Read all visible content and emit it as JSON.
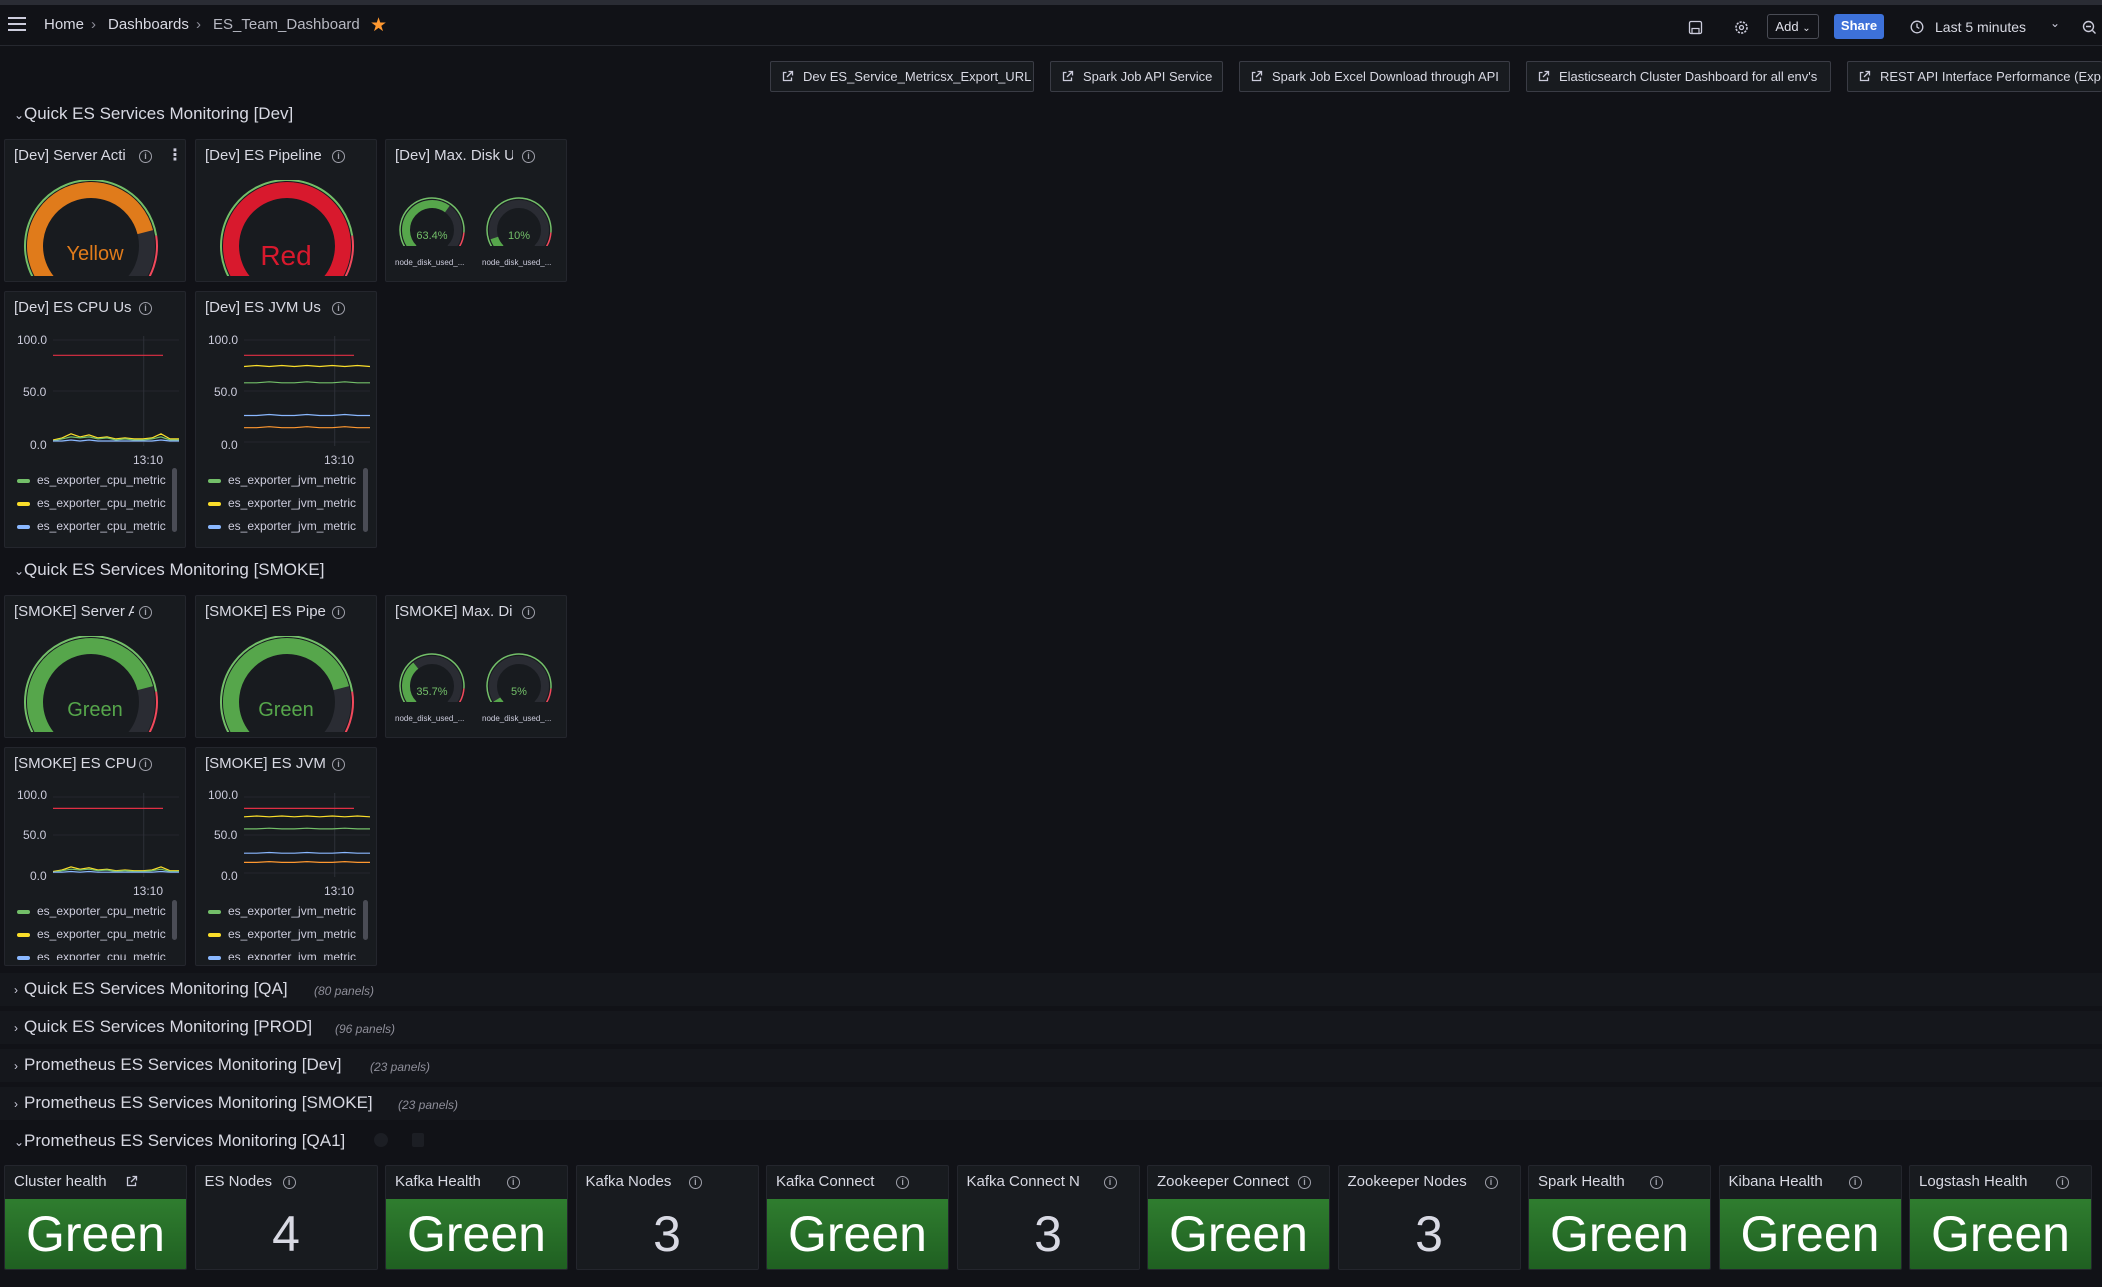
{
  "nav": {
    "breadcrumb": [
      "Home",
      "Dashboards",
      "ES_Team_Dashboard"
    ],
    "add_label": "Add",
    "share_label": "Share",
    "time_range": "Last 5 minutes"
  },
  "links": [
    "Dev ES_Service_Metricsx_Export_URL",
    "Spark Job API Service",
    "Spark Job Excel Download through API",
    "Elasticsearch Cluster Dashboard for all env's",
    "REST API Interface Performance (Exp"
  ],
  "rows": {
    "dev": "Quick ES Services Monitoring [Dev]",
    "smoke": "Quick ES Services Monitoring [SMOKE]",
    "qa": {
      "title": "Quick ES Services Monitoring [QA]",
      "count": "(80 panels)"
    },
    "prod": {
      "title": "Quick ES Services Monitoring [PROD]",
      "count": "(96 panels)"
    },
    "prom_dev": {
      "title": "Prometheus ES Services Monitoring [Dev]",
      "count": "(23 panels)"
    },
    "prom_smoke": {
      "title": "Prometheus ES Services Monitoring [SMOKE]",
      "count": "(23 panels)"
    },
    "prom_qa1": "Prometheus ES Services Monitoring [QA1]"
  },
  "dev": {
    "server": {
      "title": "[Dev] Server Acti",
      "value": "Yellow",
      "color": "#e07b1b",
      "fraction": 0.78
    },
    "pipeline": {
      "title": "[Dev] ES Pipeline",
      "value": "Red",
      "color": "#d8192d",
      "fraction": 1.0
    },
    "disk": {
      "title": "[Dev] Max. Disk U",
      "gauges": [
        {
          "value": "63.4%",
          "fraction": 0.634,
          "label": "node_disk_used_..."
        },
        {
          "value": "10%",
          "fraction": 0.1,
          "label": "node_disk_used_..."
        }
      ]
    },
    "cpu": {
      "title": "[Dev] ES CPU Us",
      "yticks": [
        "100.0",
        "50.0",
        "0.0"
      ],
      "xtick": "13:10",
      "legend": [
        "es_exporter_cpu_metric",
        "es_exporter_cpu_metric",
        "es_exporter_cpu_metric"
      ]
    },
    "jvm": {
      "title": "[Dev] ES JVM Us",
      "yticks": [
        "100.0",
        "50.0",
        "0.0"
      ],
      "xtick": "13:10",
      "legend": [
        "es_exporter_jvm_metric",
        "es_exporter_jvm_metric",
        "es_exporter_jvm_metric"
      ]
    }
  },
  "smoke": {
    "server": {
      "title": "[SMOKE] Server A",
      "value": "Green",
      "color": "#56a64b",
      "fraction": 0.78
    },
    "pipeline": {
      "title": "[SMOKE] ES Pipe",
      "value": "Green",
      "color": "#56a64b",
      "fraction": 0.78
    },
    "disk": {
      "title": "[SMOKE] Max. Di",
      "gauges": [
        {
          "value": "35.7%",
          "fraction": 0.357,
          "label": "node_disk_used_..."
        },
        {
          "value": "5%",
          "fraction": 0.05,
          "label": "node_disk_used_..."
        }
      ]
    },
    "cpu": {
      "title": "[SMOKE] ES CPU",
      "yticks": [
        "100.0",
        "50.0",
        "0.0"
      ],
      "xtick": "13:10",
      "legend": [
        "es_exporter_cpu_metric",
        "es_exporter_cpu_metric",
        "es_exporter_cpu_metric"
      ]
    },
    "jvm": {
      "title": "[SMOKE] ES JVM",
      "yticks": [
        "100.0",
        "50.0",
        "0.0"
      ],
      "xtick": "13:10",
      "legend": [
        "es_exporter_jvm_metric",
        "es_exporter_jvm_metric",
        "es_exporter_jvm_metric"
      ]
    }
  },
  "stats": [
    {
      "title": "Cluster health",
      "value": "Green",
      "green": true,
      "link": true
    },
    {
      "title": "ES Nodes",
      "value": "4",
      "green": false
    },
    {
      "title": "Kafka Health",
      "value": "Green",
      "green": true
    },
    {
      "title": "Kafka Nodes",
      "value": "3",
      "green": false
    },
    {
      "title": "Kafka Connect",
      "value": "Green",
      "green": true
    },
    {
      "title": "Kafka Connect N",
      "value": "3",
      "green": false
    },
    {
      "title": "Zookeeper Connect",
      "value": "Green",
      "green": true
    },
    {
      "title": "Zookeeper Nodes",
      "value": "3",
      "green": false
    },
    {
      "title": "Spark Health",
      "value": "Green",
      "green": true
    },
    {
      "title": "Kibana Health",
      "value": "Green",
      "green": true
    },
    {
      "title": "Logstash Health",
      "value": "Green",
      "green": true
    }
  ],
  "colors": {
    "green": "#73bf69",
    "yellow": "#fade2a",
    "blue": "#8ab8ff",
    "red": "#f2495c",
    "orange": "#ff9830"
  }
}
